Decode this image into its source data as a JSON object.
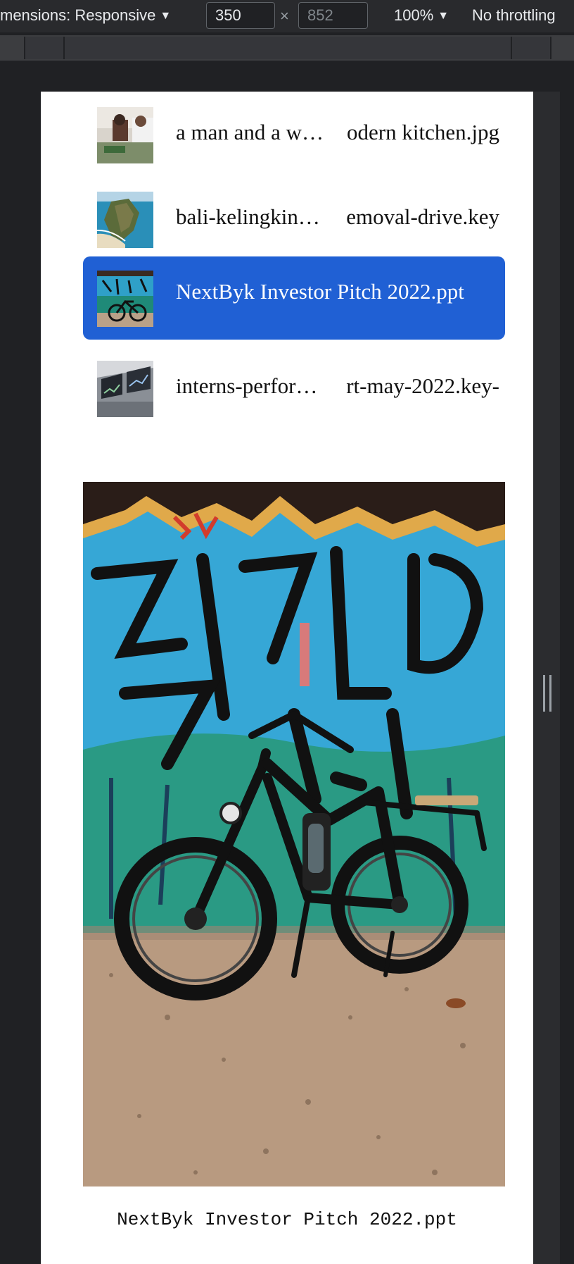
{
  "toolbar": {
    "dimensions_label": "mensions: Responsive",
    "width_value": "350",
    "height_value": "852",
    "times_symbol": "×",
    "zoom": "100%",
    "throttle": "No throttling",
    "caret": "▼"
  },
  "files": [
    {
      "name_start": "a man and a w…",
      "name_end": "odern kitchen.jpg",
      "thumbnail": "kitchen-photo-thumbnail",
      "selected": false
    },
    {
      "name_start": "bali-kelingkin…",
      "name_end": "emoval-drive.key",
      "thumbnail": "beach-cliff-thumbnail",
      "selected": false
    },
    {
      "name_full": "NextByk Investor Pitch 2022.ppt",
      "thumbnail": "bike-graffiti-thumbnail",
      "selected": true
    },
    {
      "name_start": "interns-perfor…",
      "name_end": "rt-may-2022.key-",
      "thumbnail": "dashboard-screens-thumbnail",
      "selected": false
    }
  ],
  "preview": {
    "image": "ebike-against-graffiti-wall",
    "caption": "NextByk Investor Pitch 2022.ppt"
  },
  "colors": {
    "selected_row": "#2060d4",
    "devtools_bg": "#202124"
  }
}
